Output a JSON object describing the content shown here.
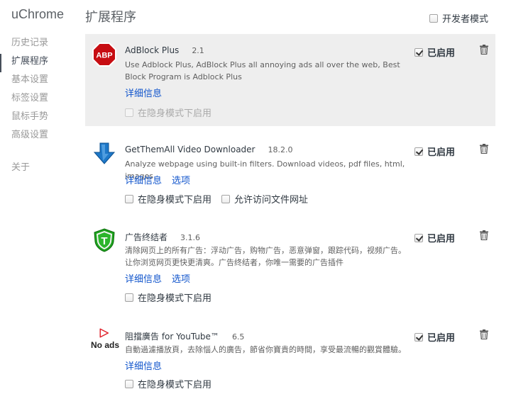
{
  "app": {
    "brand": "uChrome"
  },
  "sidebar": {
    "items": [
      {
        "label": "历史记录"
      },
      {
        "label": "扩展程序"
      },
      {
        "label": "基本设置"
      },
      {
        "label": "标签设置"
      },
      {
        "label": "鼠标手势"
      },
      {
        "label": "高级设置"
      }
    ],
    "about": "关于"
  },
  "header": {
    "title": "扩展程序",
    "devmode_label": "开发者模式"
  },
  "extensions": [
    {
      "name": "AdBlock Plus",
      "version": "2.1",
      "description": "Use Adblock Plus, AdBlock Plus all annoying ads all over the web, Best Block Program is Adblock Plus",
      "details_link": "详细信息",
      "incognito_label": "在隐身模式下启用",
      "enabled_label": "已启用",
      "icon": "abp-stop-icon",
      "icon_text": "ABP",
      "color": "#c70d12"
    },
    {
      "name": "GetThemAll Video Downloader",
      "version": "18.2.0",
      "description": "Analyze webpage using built-in filters. Download videos, pdf files, html, images",
      "details_link": "详细信息",
      "options_link": "选项",
      "incognito_label": "在隐身模式下启用",
      "file_access_label": "允许访问文件网址",
      "enabled_label": "已启用",
      "icon": "download-arrow-icon",
      "color": "#1e78c8"
    },
    {
      "name": "广告终结者",
      "version": "3.1.6",
      "description": "清除网页上的所有广告：浮动广告，购物广告，恶意弹窗，跟踪代码，视频广告。让你浏览网页更快更清爽。广告终结者，你唯一需要的广告插件",
      "details_link": "详细信息",
      "options_link": "选项",
      "incognito_label": "在隐身模式下启用",
      "enabled_label": "已启用",
      "icon": "shield-t-icon",
      "icon_text": "T",
      "color": "#1fa31f"
    },
    {
      "name": "阻擋廣告 for YouTube™",
      "version": "6.5",
      "description": "自動過濾播放頁，去除惱人的廣告，節省你寶貴的時間，享受最流暢的觀賞體驗。",
      "details_link": "详细信息",
      "incognito_label": "在隐身模式下启用",
      "enabled_label": "已启用",
      "icon": "play-outline-icon",
      "icon_text": "No ads",
      "color": "#e0202a"
    }
  ]
}
